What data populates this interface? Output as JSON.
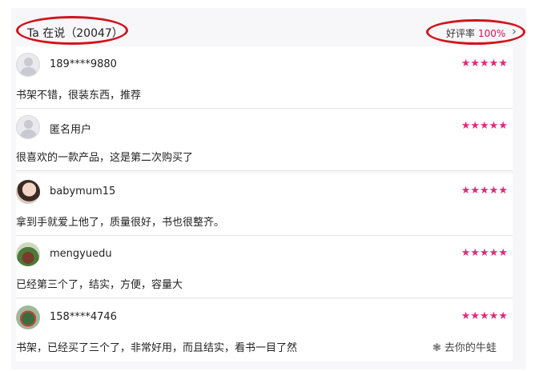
{
  "header": {
    "title": "Ta 在说（20047）",
    "rate_label": "好评率",
    "rate_value": "100%",
    "chevron_icon": "chevron-right-icon"
  },
  "reviews": [
    {
      "user": "189****9880",
      "rating": 5,
      "stars": "★★★★★",
      "text": "书架不错，很装东西，推荐",
      "avatar": "default-avatar"
    },
    {
      "user": "匿名用户",
      "rating": 5,
      "stars": "★★★★★",
      "text": "很喜欢的一款产品，这是第二次购买了",
      "avatar": "default-avatar"
    },
    {
      "user": "babymum15",
      "rating": 5,
      "stars": "★★★★★",
      "text": "拿到手就爱上他了，质量很好，书也很整齐。",
      "avatar": "photo-avatar"
    },
    {
      "user": "mengyuedu",
      "rating": 5,
      "stars": "★★★★★",
      "text": "已经第三个了，结实，方便，容量大",
      "avatar": "photo-avatar"
    },
    {
      "user": "158****4746",
      "rating": 5,
      "stars": "★★★★★",
      "text": "书架，已经买了三个了，非常好用，而且结实，看书一目了然",
      "avatar": "photo-avatar"
    }
  ],
  "watermark": {
    "text": "去你的牛蛙"
  },
  "colors": {
    "accent": "#d4145a",
    "stars": "#e0297b",
    "highlight_ring": "#d0141c"
  }
}
